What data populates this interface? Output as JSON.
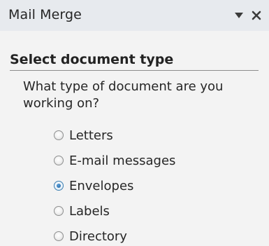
{
  "pane": {
    "title": "Mail Merge",
    "dropdown_icon": "chevron-down-icon",
    "close_icon": "close-icon"
  },
  "section": {
    "header": "Select document type",
    "question": "What type of document are you working on?"
  },
  "document_types": [
    {
      "label": "Letters",
      "checked": false
    },
    {
      "label": "E-mail messages",
      "checked": false
    },
    {
      "label": "Envelopes",
      "checked": true
    },
    {
      "label": "Labels",
      "checked": false
    },
    {
      "label": "Directory",
      "checked": false
    }
  ],
  "colors": {
    "titlebar_bg": "#e7eaee",
    "pane_bg": "#f3f3f3",
    "text": "#262626",
    "accent": "#1f5f9a"
  }
}
